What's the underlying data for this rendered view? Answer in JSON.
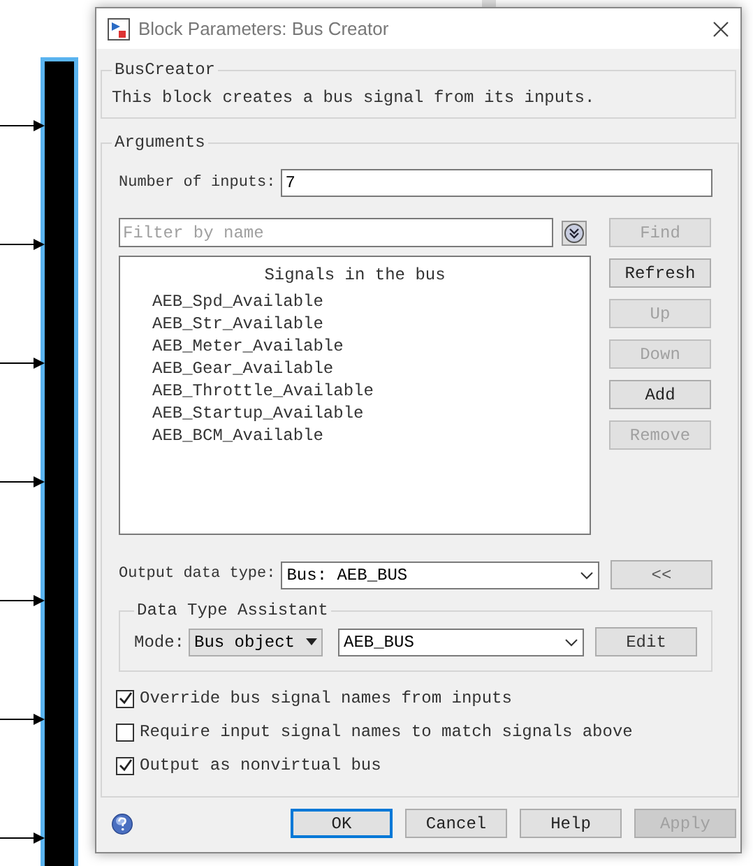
{
  "window": {
    "title": "Block Parameters: Bus Creator"
  },
  "description_group": {
    "title": "BusCreator",
    "text": "This block creates a bus signal from its inputs."
  },
  "arguments": {
    "title": "Arguments",
    "number_of_inputs": {
      "label": "Number of inputs:",
      "value": "7"
    },
    "filter": {
      "placeholder": "Filter by name"
    },
    "signals_heading": "Signals in the bus",
    "signals": [
      "AEB_Spd_Available",
      "AEB_Str_Available",
      "AEB_Meter_Available",
      "AEB_Gear_Available",
      "AEB_Throttle_Available",
      "AEB_Startup_Available",
      "AEB_BCM_Available"
    ],
    "side_buttons": [
      {
        "label": "Find",
        "disabled": true
      },
      {
        "label": "Refresh",
        "disabled": false
      },
      {
        "label": "Up",
        "disabled": true
      },
      {
        "label": "Down",
        "disabled": true
      },
      {
        "label": "Add",
        "disabled": false
      },
      {
        "label": "Remove",
        "disabled": true
      }
    ],
    "output_data_type": {
      "label": "Output data type:",
      "value": "Bus: AEB_BUS",
      "toggle": "<<"
    },
    "assistant": {
      "title": "Data Type Assistant",
      "mode_label": "Mode:",
      "mode": "Bus object",
      "bus": "AEB_BUS",
      "edit": "Edit"
    },
    "options": [
      {
        "label": "Override bus signal names from inputs",
        "checked": true
      },
      {
        "label": "Require input signal names to match signals above",
        "checked": false
      },
      {
        "label": "Output as nonvirtual bus",
        "checked": true
      }
    ]
  },
  "footer_buttons": [
    {
      "label": "OK",
      "focused": true,
      "disabled": false
    },
    {
      "label": "Cancel",
      "focused": false,
      "disabled": false
    },
    {
      "label": "Help",
      "focused": false,
      "disabled": false
    },
    {
      "label": "Apply",
      "focused": false,
      "disabled": true
    }
  ]
}
